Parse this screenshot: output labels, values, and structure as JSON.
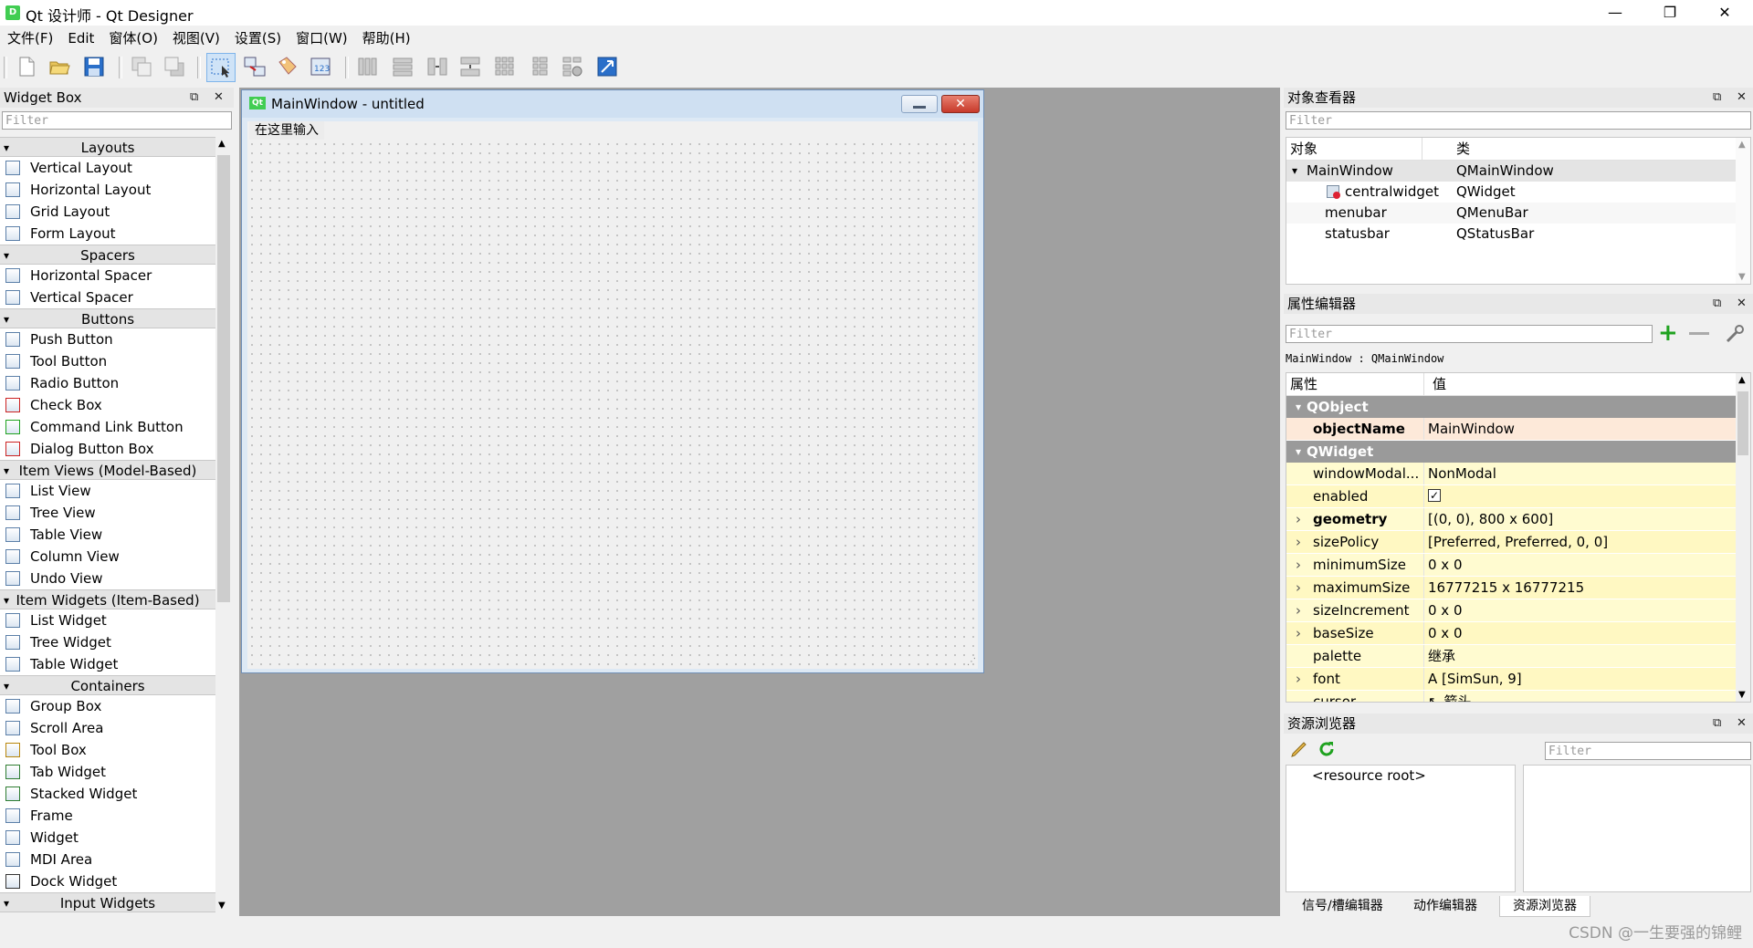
{
  "window": {
    "title": "Qt 设计师 - Qt Designer",
    "icon": "D",
    "controls": {
      "minimize": "—",
      "maximize": "❐",
      "close": "✕"
    }
  },
  "menubar": {
    "items": [
      "文件(F)",
      "Edit",
      "窗体(O)",
      "视图(V)",
      "设置(S)",
      "窗口(W)",
      "帮助(H)"
    ]
  },
  "toolbar": {
    "icons": [
      "new-file-icon",
      "open-folder-icon",
      "save-icon",
      "send-to-back-icon",
      "bring-to-front-icon",
      "edit-widgets-icon",
      "edit-signals-slots-icon",
      "edit-buddies-icon",
      "edit-tab-order-icon",
      "layout-horizontal-icon",
      "layout-vertical-icon",
      "layout-horizontal-splitter-icon",
      "layout-vertical-splitter-icon",
      "layout-grid-icon",
      "layout-form-icon",
      "break-layout-icon",
      "adjust-size-icon"
    ]
  },
  "widgetbox": {
    "title": "Widget Box",
    "filter_placeholder": "Filter",
    "categories": [
      {
        "name": "Layouts",
        "items": [
          {
            "label": "Vertical Layout",
            "icon": "vertical-layout-icon"
          },
          {
            "label": "Horizontal Layout",
            "icon": "horizontal-layout-icon"
          },
          {
            "label": "Grid Layout",
            "icon": "grid-layout-icon"
          },
          {
            "label": "Form Layout",
            "icon": "form-layout-icon"
          }
        ]
      },
      {
        "name": "Spacers",
        "items": [
          {
            "label": "Horizontal Spacer",
            "icon": "horizontal-spacer-icon"
          },
          {
            "label": "Vertical Spacer",
            "icon": "vertical-spacer-icon"
          }
        ]
      },
      {
        "name": "Buttons",
        "items": [
          {
            "label": "Push Button",
            "icon": "push-button-icon"
          },
          {
            "label": "Tool Button",
            "icon": "tool-button-icon"
          },
          {
            "label": "Radio Button",
            "icon": "radio-button-icon"
          },
          {
            "label": "Check Box",
            "icon": "check-box-icon"
          },
          {
            "label": "Command Link Button",
            "icon": "command-link-icon"
          },
          {
            "label": "Dialog Button Box",
            "icon": "dialog-button-box-icon"
          }
        ]
      },
      {
        "name": "Item Views (Model-Based)",
        "items": [
          {
            "label": "List View",
            "icon": "list-view-icon"
          },
          {
            "label": "Tree View",
            "icon": "tree-view-icon"
          },
          {
            "label": "Table View",
            "icon": "table-view-icon"
          },
          {
            "label": "Column View",
            "icon": "column-view-icon"
          },
          {
            "label": "Undo View",
            "icon": "undo-view-icon"
          }
        ]
      },
      {
        "name": "Item Widgets (Item-Based)",
        "items": [
          {
            "label": "List Widget",
            "icon": "list-widget-icon"
          },
          {
            "label": "Tree Widget",
            "icon": "tree-widget-icon"
          },
          {
            "label": "Table Widget",
            "icon": "table-widget-icon"
          }
        ]
      },
      {
        "name": "Containers",
        "items": [
          {
            "label": "Group Box",
            "icon": "group-box-icon"
          },
          {
            "label": "Scroll Area",
            "icon": "scroll-area-icon"
          },
          {
            "label": "Tool Box",
            "icon": "tool-box-icon"
          },
          {
            "label": "Tab Widget",
            "icon": "tab-widget-icon"
          },
          {
            "label": "Stacked Widget",
            "icon": "stacked-widget-icon"
          },
          {
            "label": "Frame",
            "icon": "frame-icon"
          },
          {
            "label": "Widget",
            "icon": "widget-icon"
          },
          {
            "label": "MDI Area",
            "icon": "mdi-area-icon"
          },
          {
            "label": "Dock Widget",
            "icon": "dock-widget-icon"
          }
        ]
      },
      {
        "name": "Input Widgets",
        "items": []
      }
    ]
  },
  "form": {
    "title": "MainWindow - untitled",
    "icon": "Qt",
    "menu_placeholder": "在这里输入"
  },
  "object_inspector": {
    "title": "对象查看器",
    "filter_placeholder": "Filter",
    "headers": {
      "object": "对象",
      "class": "类"
    },
    "rows": [
      {
        "object": "MainWindow",
        "class": "QMainWindow",
        "level": 0,
        "expanded": true
      },
      {
        "object": "centralwidget",
        "class": "QWidget",
        "level": 1
      },
      {
        "object": "menubar",
        "class": "QMenuBar",
        "level": 1
      },
      {
        "object": "statusbar",
        "class": "QStatusBar",
        "level": 1
      }
    ]
  },
  "property_editor": {
    "title": "属性编辑器",
    "filter_placeholder": "Filter",
    "context": "MainWindow : QMainWindow",
    "headers": {
      "property": "属性",
      "value": "值"
    },
    "groups": [
      {
        "name": "QObject",
        "props": [
          {
            "name": "objectName",
            "value": "MainWindow",
            "bold": true,
            "expandable": false
          }
        ]
      },
      {
        "name": "QWidget",
        "props": [
          {
            "name": "windowModal...",
            "value": "NonModal",
            "expandable": false
          },
          {
            "name": "enabled",
            "value": "✓",
            "expandable": false,
            "checkbox": true
          },
          {
            "name": "geometry",
            "value": "[(0, 0), 800 x 600]",
            "bold": true,
            "expandable": true
          },
          {
            "name": "sizePolicy",
            "value": "[Preferred, Preferred, 0, 0]",
            "expandable": true
          },
          {
            "name": "minimumSize",
            "value": "0 x 0",
            "expandable": true
          },
          {
            "name": "maximumSize",
            "value": "16777215 x 16777215",
            "expandable": true
          },
          {
            "name": "sizeIncrement",
            "value": "0 x 0",
            "expandable": true
          },
          {
            "name": "baseSize",
            "value": "0 x 0",
            "expandable": true
          },
          {
            "name": "palette",
            "value": "继承",
            "expandable": false
          },
          {
            "name": "font",
            "value": "A  [SimSun, 9]",
            "expandable": true
          },
          {
            "name": "cursor",
            "value": "↖  箭头",
            "expandable": false
          }
        ]
      }
    ]
  },
  "resource_browser": {
    "title": "资源浏览器",
    "filter_placeholder": "Filter",
    "root": "<resource root>"
  },
  "bottom_tabs": [
    "信号/槽编辑器",
    "动作编辑器",
    "资源浏览器"
  ],
  "watermark": "CSDN @一生要强的锦鲤",
  "colors": {
    "group_bg": "#9a9a9a",
    "highlight_row": "#fde9d9",
    "prop_row": "#fffbd0",
    "workspace": "#a0a0a0",
    "accent_green": "#41cd52"
  }
}
